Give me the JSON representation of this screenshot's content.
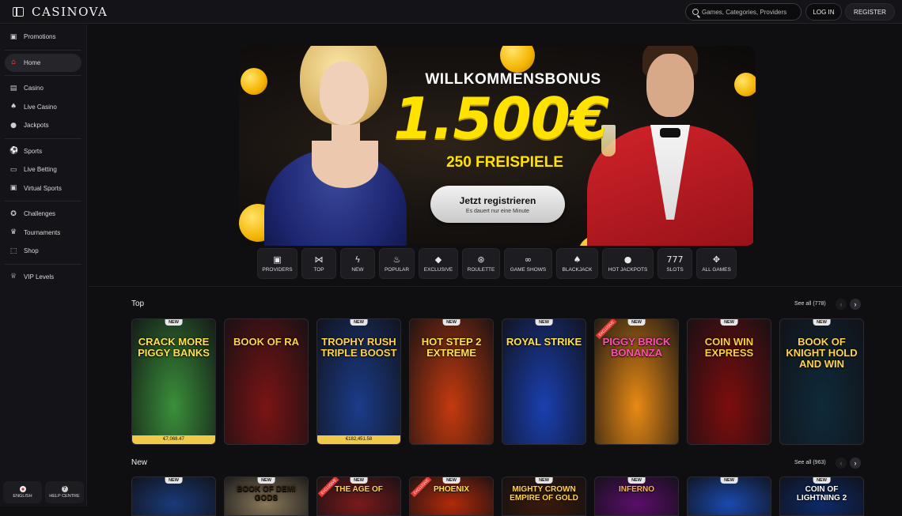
{
  "header": {
    "logo": "CASINOVA",
    "search_placeholder": "Games, Categories, Providers",
    "login": "LOG IN",
    "register": "REGISTER"
  },
  "sidebar": {
    "items": [
      {
        "label": "Promotions",
        "icon": "gift-icon"
      },
      {
        "label": "Home",
        "icon": "home-icon",
        "active": true
      },
      {
        "label": "Casino",
        "icon": "slot-machine-icon"
      },
      {
        "label": "Live Casino",
        "icon": "dealer-icon"
      },
      {
        "label": "Jackpots",
        "icon": "coins-icon"
      },
      {
        "label": "Sports",
        "icon": "soccer-ball-icon"
      },
      {
        "label": "Live Betting",
        "icon": "live-icon"
      },
      {
        "label": "Virtual Sports",
        "icon": "virtual-screen-icon"
      },
      {
        "label": "Challenges",
        "icon": "medal-icon"
      },
      {
        "label": "Tournaments",
        "icon": "trophy-icon"
      },
      {
        "label": "Shop",
        "icon": "shop-icon"
      },
      {
        "label": "VIP Levels",
        "icon": "crown-icon"
      }
    ],
    "language": "ENGLISH",
    "help": "HELP CENTRE"
  },
  "hero": {
    "title": "WILLKOMMENSBONUS",
    "amount": "1.500€",
    "subtitle": "250 FREISPIELE",
    "cta_label": "Jetzt registrieren",
    "cta_sub": "Es dauert nur eine Minute"
  },
  "categories": [
    {
      "label": "PROVIDERS",
      "icon": "providers-icon"
    },
    {
      "label": "TOP",
      "icon": "bow-icon"
    },
    {
      "label": "NEW",
      "icon": "bolt-icon"
    },
    {
      "label": "POPULAR",
      "icon": "flame-icon"
    },
    {
      "label": "EXCLUSIVE",
      "icon": "diamond-icon"
    },
    {
      "label": "ROULETTE",
      "icon": "roulette-icon"
    },
    {
      "label": "GAME SHOWS",
      "icon": "mask-icon"
    },
    {
      "label": "BLACKJACK",
      "icon": "cards-icon"
    },
    {
      "label": "HOT JACKPOTS",
      "icon": "hot-coin-icon"
    },
    {
      "label": "SLOTS",
      "icon": "777-icon"
    },
    {
      "label": "ALL GAMES",
      "icon": "grid-icon"
    }
  ],
  "sections": {
    "top": {
      "title": "Top",
      "see_all": "See all (778)",
      "games": [
        {
          "name": "CRACK MORE PIGGY BANKS",
          "badge": "NEW",
          "jackpot": "€7,068.47",
          "bg": "#3a8f3a",
          "color": "#ffe04a"
        },
        {
          "name": "BOOK OF RA",
          "badge": "",
          "jackpot": "",
          "bg": "#7a1414",
          "color": "#ffd34a"
        },
        {
          "name": "TROPHY RUSH TRIPLE BOOST",
          "badge": "NEW",
          "jackpot": "€182,451.58",
          "bg": "#1b3c8a",
          "color": "#ffd34a"
        },
        {
          "name": "HOT STEP 2 EXTREME",
          "badge": "NEW",
          "jackpot": "",
          "bg": "#c43a0e",
          "color": "#ffe14a"
        },
        {
          "name": "ROYAL STRIKE",
          "badge": "NEW",
          "jackpot": "",
          "bg": "#1a3fb0",
          "color": "#ffe14a"
        },
        {
          "name": "PIGGY BRICK BONANZA",
          "badge": "NEW",
          "jackpot": "",
          "bg": "#e88a14",
          "color": "#ff4fb0",
          "exclusive": "EXCLUSIVE"
        },
        {
          "name": "COIN WIN EXPRESS",
          "badge": "NEW",
          "jackpot": "",
          "bg": "#7d0d0d",
          "color": "#ffcf3a"
        },
        {
          "name": "BOOK OF KNIGHT HOLD AND WIN",
          "badge": "NEW",
          "jackpot": "",
          "bg": "#0f2a3a",
          "color": "#ffd34a"
        }
      ]
    },
    "new": {
      "title": "New",
      "see_all": "See all (963)",
      "games": [
        {
          "name": "",
          "badge": "NEW",
          "bg": "#1a3a7a",
          "color": "#fff"
        },
        {
          "name": "BOOK OF DEMI GODS",
          "badge": "NEW",
          "bg": "#8a7a5a",
          "color": "#2a1a0a"
        },
        {
          "name": "THE AGE OF",
          "badge": "NEW",
          "bg": "#7a1a1a",
          "color": "#ffd34a",
          "exclusive": "EXCLUSIVE"
        },
        {
          "name": "PHOENIX",
          "badge": "NEW",
          "bg": "#b32a0a",
          "color": "#ffe14a",
          "exclusive": "EXCLUSIVE"
        },
        {
          "name": "MIGHTY CROWN EMPIRE OF GOLD",
          "badge": "NEW",
          "bg": "#3a1a0a",
          "color": "#ffd34a"
        },
        {
          "name": "INFERNO",
          "badge": "NEW",
          "bg": "#5a0e6a",
          "color": "#ffb04a"
        },
        {
          "name": "",
          "badge": "NEW",
          "bg": "#1a4ab0",
          "color": "#ffe14a"
        },
        {
          "name": "COIN OF LIGHTNING 2",
          "badge": "NEW",
          "bg": "#0e2a6a",
          "color": "#ffffff"
        }
      ]
    }
  },
  "colors": {
    "accent": "#e03a3a",
    "gold": "#ffe200",
    "bg": "#0f0f12"
  }
}
